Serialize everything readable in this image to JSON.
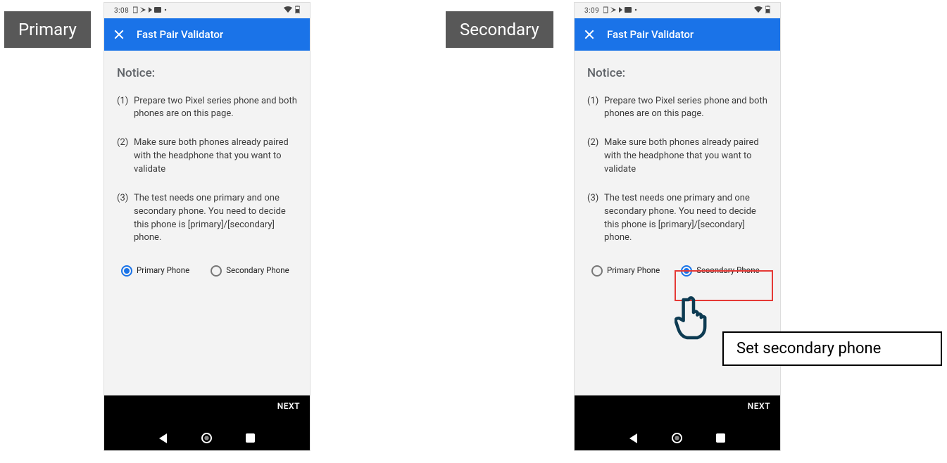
{
  "tags": {
    "primary": "Primary",
    "secondary": "Secondary"
  },
  "callout": "Set secondary phone",
  "phone1": {
    "time": "3:08",
    "status_icons_label": "status icons",
    "appbar_title": "Fast Pair Validator",
    "notice_title": "Notice:",
    "steps": [
      {
        "num": "(1)",
        "text": "Prepare two Pixel series phone and both phones are on this page."
      },
      {
        "num": "(2)",
        "text": "Make sure both phones already paired with the headphone that you want to validate"
      },
      {
        "num": "(3)",
        "text": "The test needs one primary and one secondary phone. You need to decide this phone is [primary]/[secondary] phone."
      }
    ],
    "radio_primary": "Primary Phone",
    "radio_secondary": "Secondary Phone",
    "next": "NEXT"
  },
  "phone2": {
    "time": "3:09",
    "status_icons_label": "status icons",
    "appbar_title": "Fast Pair Validator",
    "notice_title": "Notice:",
    "steps": [
      {
        "num": "(1)",
        "text": "Prepare two Pixel series phone and both phones are on this page."
      },
      {
        "num": "(2)",
        "text": "Make sure both phones already paired with the headphone that you want to validate"
      },
      {
        "num": "(3)",
        "text": "The test needs one primary and one secondary phone. You need to decide this phone is [primary]/[secondary] phone."
      }
    ],
    "radio_primary": "Primary Phone",
    "radio_secondary": "Secondary Phone",
    "next": "NEXT"
  }
}
